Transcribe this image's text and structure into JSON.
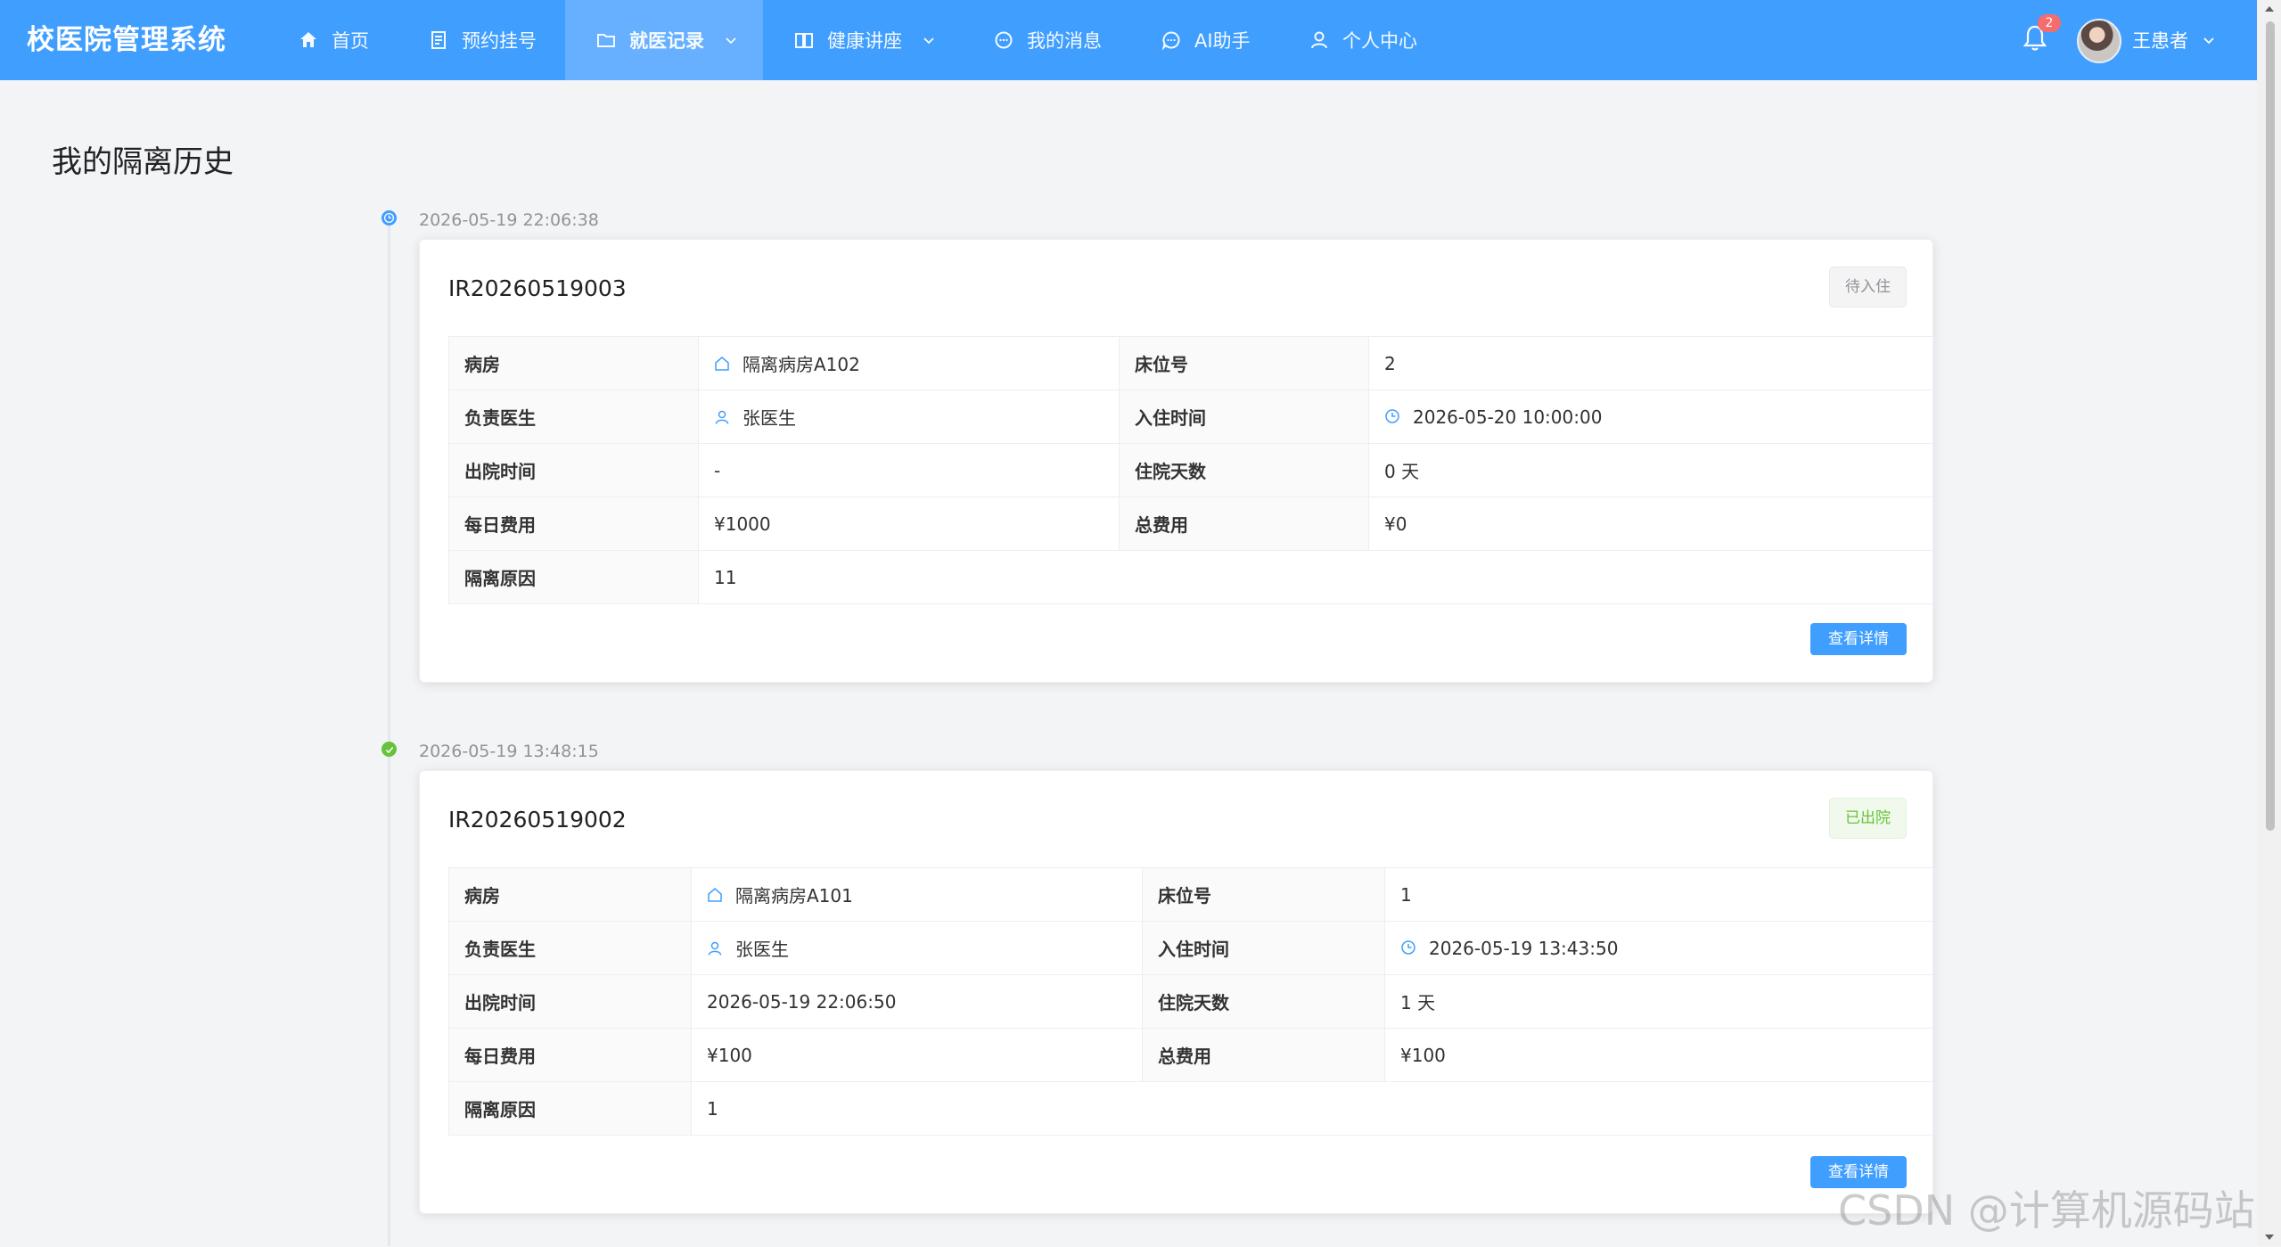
{
  "app": {
    "title": "校医院管理系统"
  },
  "nav": {
    "home": "首页",
    "appointment": "预约挂号",
    "records": "就医记录",
    "lectures": "健康讲座",
    "messages": "我的消息",
    "ai": "AI助手",
    "profile": "个人中心"
  },
  "user": {
    "name": "王患者",
    "badge": "2"
  },
  "page": {
    "title": "我的隔离历史"
  },
  "labels": {
    "ward": "病房",
    "bed": "床位号",
    "doctor": "负责医生",
    "checkin": "入住时间",
    "discharge": "出院时间",
    "days": "住院天数",
    "daily_fee": "每日费用",
    "total_fee": "总费用",
    "reason": "隔离原因",
    "detail_button": "查看详情"
  },
  "records": [
    {
      "timestamp": "2026-05-19 22:06:38",
      "id": "IR20260519003",
      "status": "待入住",
      "ward": "隔离病房A102",
      "bed": "2",
      "doctor": "张医生",
      "checkin": "2026-05-20 10:00:00",
      "discharge": "-",
      "days": "0 天",
      "daily_fee": "¥1000",
      "total_fee": "¥0",
      "reason": "11"
    },
    {
      "timestamp": "2026-05-19 13:48:15",
      "id": "IR20260519002",
      "status": "已出院",
      "ward": "隔离病房A101",
      "bed": "1",
      "doctor": "张医生",
      "checkin": "2026-05-19 13:43:50",
      "discharge": "2026-05-19 22:06:50",
      "days": "1 天",
      "daily_fee": "¥100",
      "total_fee": "¥100",
      "reason": "1"
    }
  ],
  "watermark": "CSDN @计算机源码站"
}
